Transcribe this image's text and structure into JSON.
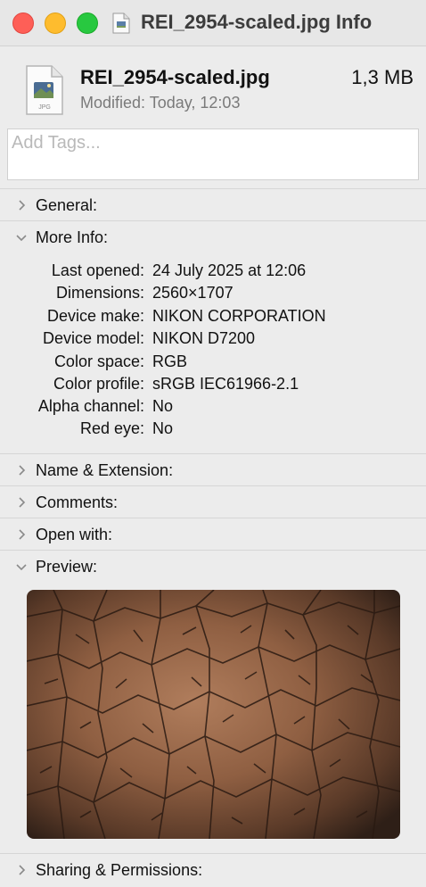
{
  "window": {
    "title": "REI_2954-scaled.jpg Info"
  },
  "file": {
    "name": "REI_2954-scaled.jpg",
    "size": "1,3 MB",
    "modified": "Modified: Today, 12:03",
    "icon_label": "JPG"
  },
  "tags": {
    "placeholder": "Add Tags..."
  },
  "sections": {
    "general": "General:",
    "more_info": "More Info:",
    "name_extension": "Name & Extension:",
    "comments": "Comments:",
    "open_with": "Open with:",
    "preview": "Preview:",
    "sharing": "Sharing & Permissions:"
  },
  "more_info": [
    {
      "key": "Last opened:",
      "value": "24 July 2025 at 12:06"
    },
    {
      "key": "Dimensions:",
      "value": "2560×1707"
    },
    {
      "key": "Device make:",
      "value": "NIKON CORPORATION"
    },
    {
      "key": "Device model:",
      "value": "NIKON D7200"
    },
    {
      "key": "Color space:",
      "value": "RGB"
    },
    {
      "key": "Color profile:",
      "value": "sRGB IEC61966-2.1"
    },
    {
      "key": "Alpha channel:",
      "value": "No"
    },
    {
      "key": "Red eye:",
      "value": "No"
    }
  ],
  "icons": {
    "close": "close-button",
    "minimize": "minimize-button",
    "zoom": "zoom-button",
    "disclosure_collapsed": "chevron-right-icon",
    "disclosure_expanded": "chevron-down-icon"
  },
  "colors": {
    "close": "#fe5f57",
    "minimize": "#febc2e",
    "zoom": "#28c840"
  }
}
